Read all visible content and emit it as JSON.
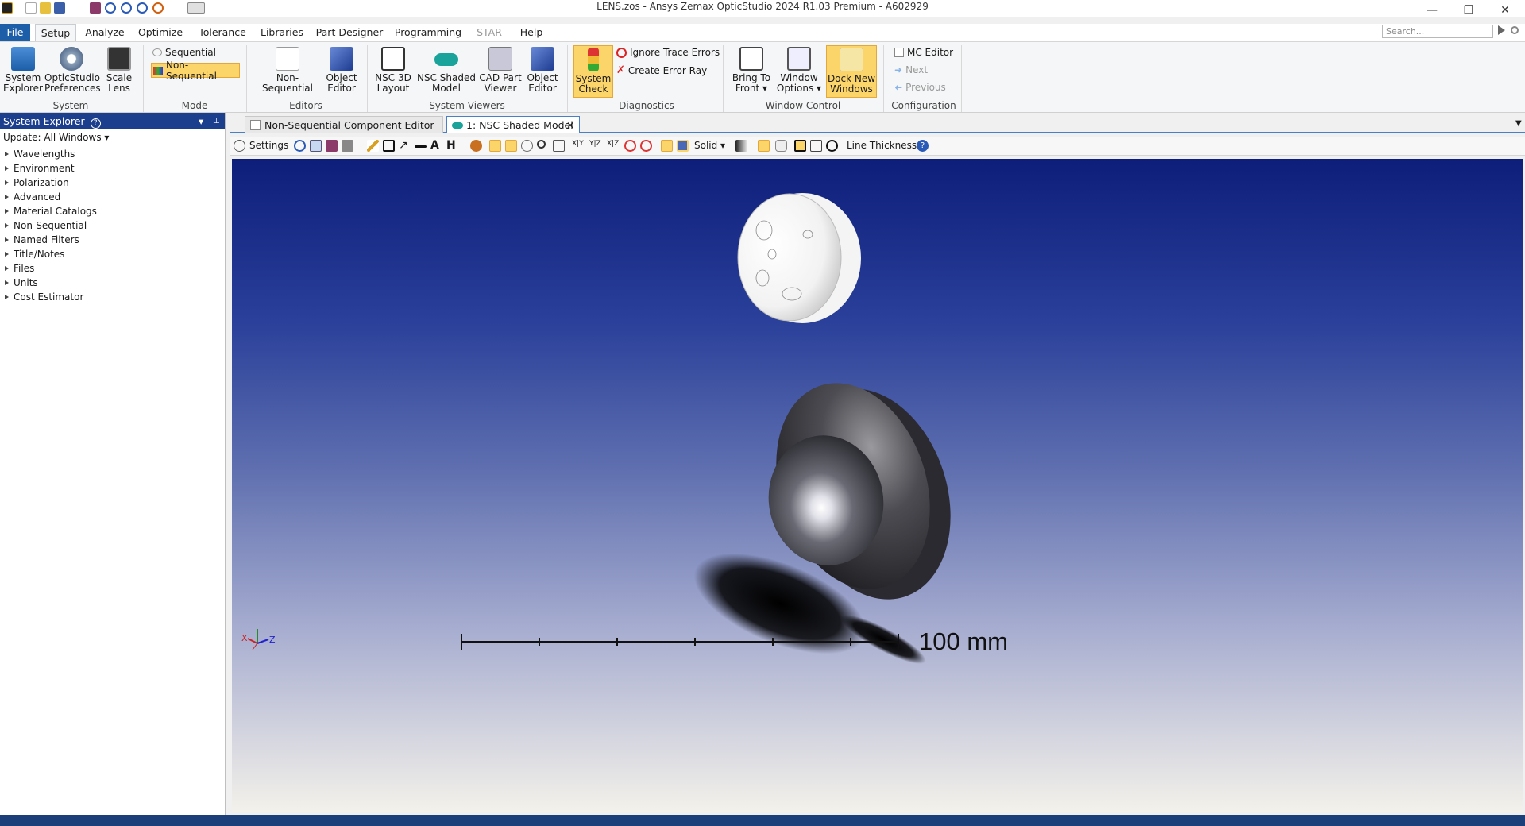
{
  "window": {
    "title": "LENS.zos - Ansys Zemax OpticStudio 2024 R1.03   Premium - A602929",
    "search_placeholder": "Search..."
  },
  "ribbon_tabs": [
    "File",
    "Setup",
    "Analyze",
    "Optimize",
    "Tolerance",
    "Libraries",
    "Part Designer",
    "Programming",
    "STAR",
    "Help"
  ],
  "ribbon": {
    "system": {
      "group": "System",
      "items": [
        {
          "label": "System\nExplorer",
          "line1": "System",
          "line2": "Explorer",
          "icon": "document-blue-icon"
        },
        {
          "line1": "OpticStudio",
          "line2": "Preferences",
          "icon": "gear-icon"
        },
        {
          "line1": "Scale",
          "line2": "Lens",
          "icon": "scale-icon"
        }
      ]
    },
    "mode": {
      "group": "Mode",
      "sequential": "Sequential",
      "non_sequential": "Non-Sequential"
    },
    "editors": {
      "group": "Editors",
      "items": [
        {
          "line1": "Non-Sequential",
          "line2": "",
          "icon": "nsc-editor-icon"
        },
        {
          "line1": "Object",
          "line2": "Editor",
          "icon": "cube-icon"
        }
      ]
    },
    "viewers": {
      "group": "System Viewers",
      "items": [
        {
          "line1": "NSC 3D",
          "line2": "Layout",
          "icon": "layout-icon"
        },
        {
          "line1": "NSC Shaded",
          "line2": "Model",
          "icon": "shaded-model-icon"
        },
        {
          "line1": "CAD Part",
          "line2": "Viewer",
          "icon": "cad-icon"
        },
        {
          "line1": "Object",
          "line2": "Editor",
          "icon": "cube-icon"
        }
      ]
    },
    "diagnostics": {
      "group": "Diagnostics",
      "system_check_1": "System",
      "system_check_2": "Check",
      "ignore": "Ignore Trace Errors",
      "create": "Create Error Ray"
    },
    "window_control": {
      "group": "Window Control",
      "items": [
        {
          "line1": "Bring To",
          "line2": "Front ▾",
          "icon": "bring-front-icon"
        },
        {
          "line1": "Window",
          "line2": "Options ▾",
          "icon": "window-options-icon"
        },
        {
          "line1": "Dock New",
          "line2": "Windows",
          "icon": "dock-icon"
        }
      ]
    },
    "configuration": {
      "group": "Configuration",
      "mc_editor": "MC Editor",
      "next": "Next",
      "previous": "Previous"
    }
  },
  "explorer": {
    "title": "System Explorer",
    "update": "Update: All Windows ▾",
    "items": [
      "Wavelengths",
      "Environment",
      "Polarization",
      "Advanced",
      "Material Catalogs",
      "Non-Sequential",
      "Named Filters",
      "Title/Notes",
      "Files",
      "Units",
      "Cost Estimator"
    ]
  },
  "doc_tabs": {
    "tab1": "Non-Sequential Component Editor",
    "tab2": "1: NSC Shaded Model"
  },
  "viewer_toolbar": {
    "settings": "Settings",
    "xy": "X|Y",
    "yz": "Y|Z",
    "xz": "X|Z",
    "solid": "Solid ▾",
    "line_thickness": "Line Thickness ▾"
  },
  "viewport": {
    "scale_label": "100 mm",
    "axis_x": "X",
    "axis_z": "Z"
  },
  "colors": {
    "accent": "#1c5ea8",
    "explorer_header": "#1b3f8c",
    "highlight": "#fbd46a"
  }
}
